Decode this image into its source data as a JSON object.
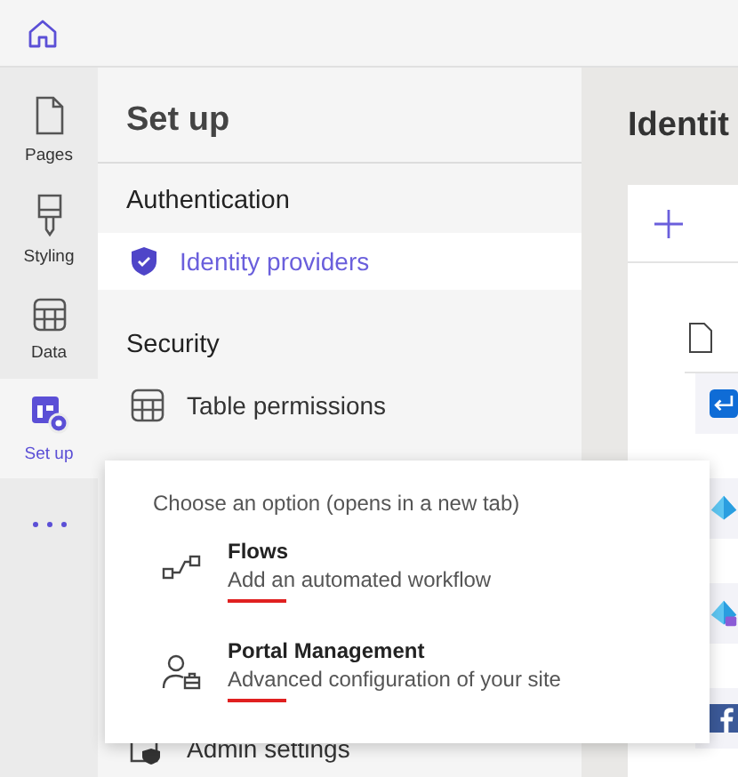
{
  "nav": {
    "items": [
      {
        "label": "Pages",
        "kind": "page",
        "selected": false
      },
      {
        "label": "Styling",
        "kind": "brush",
        "selected": false
      },
      {
        "label": "Data",
        "kind": "table",
        "selected": false
      },
      {
        "label": "Set up",
        "kind": "setup",
        "selected": true
      }
    ]
  },
  "panel": {
    "title": "Set up",
    "sections": [
      {
        "heading": "Authentication",
        "items": [
          {
            "label": "Identity providers",
            "kind": "shield",
            "selected": true
          }
        ]
      },
      {
        "heading": "Security",
        "items": [
          {
            "label": "Table permissions",
            "kind": "table",
            "selected": false
          }
        ]
      }
    ],
    "footer_item": {
      "label": "Admin settings",
      "kind": "admin"
    }
  },
  "main": {
    "heading": "Identit",
    "providers": [
      {
        "kind": "return"
      },
      {
        "kind": "azure"
      },
      {
        "kind": "azure-lock"
      },
      {
        "kind": "facebook"
      }
    ]
  },
  "popup": {
    "heading": "Choose an option (opens in a new tab)",
    "options": [
      {
        "title": "Flows",
        "description": "Add an automated workflow",
        "kind": "flow",
        "annotated": true
      },
      {
        "title": "Portal Management",
        "description": "Advanced configuration of your site",
        "kind": "person-case",
        "annotated": true
      }
    ]
  }
}
